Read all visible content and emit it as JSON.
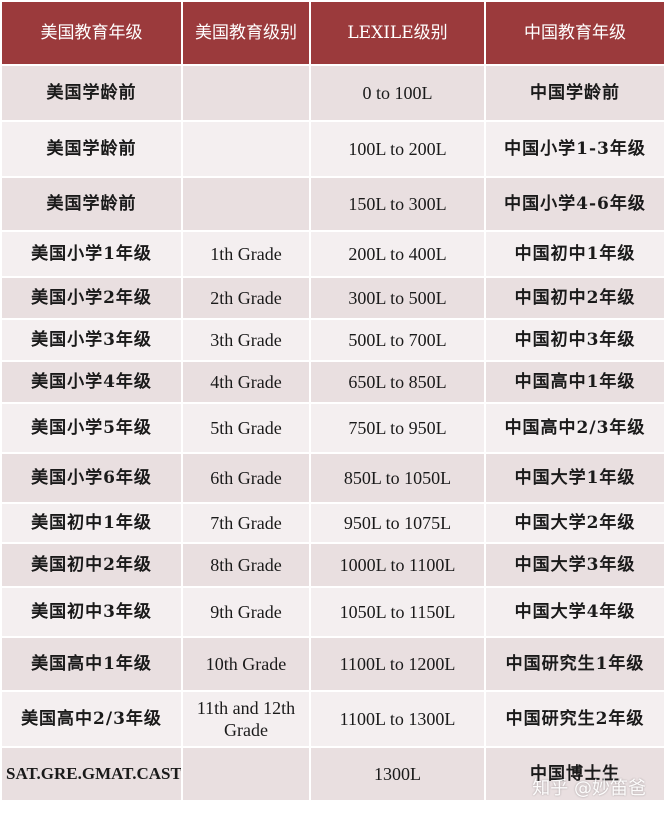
{
  "table": {
    "headers": [
      "美国教育年级",
      "美国教育级别",
      "LEXILE级别",
      "中国教育年级"
    ],
    "rows": [
      [
        "美国学龄前",
        "",
        "0 to 100L",
        "中国学龄前"
      ],
      [
        "美国学龄前",
        "",
        "100L to 200L",
        "中国小学1-3年级"
      ],
      [
        "美国学龄前",
        "",
        "150L to 300L",
        "中国小学4-6年级"
      ],
      [
        "美国小学1年级",
        "1th Grade",
        "200L to 400L",
        "中国初中1年级"
      ],
      [
        "美国小学2年级",
        "2th Grade",
        "300L to 500L",
        "中国初中2年级"
      ],
      [
        "美国小学3年级",
        "3th Grade",
        "500L to 700L",
        "中国初中3年级"
      ],
      [
        "美国小学4年级",
        "4th Grade",
        "650L to 850L",
        "中国高中1年级"
      ],
      [
        "美国小学5年级",
        "5th Grade",
        "750L to 950L",
        "中国高中2/3年级"
      ],
      [
        "美国小学6年级",
        "6th Grade",
        "850L to 1050L",
        "中国大学1年级"
      ],
      [
        "美国初中1年级",
        "7th Grade",
        "950L to 1075L",
        "中国大学2年级"
      ],
      [
        "美国初中2年级",
        "8th Grade",
        "1000L to 1100L",
        "中国大学3年级"
      ],
      [
        "美国初中3年级",
        "9th Grade",
        "1050L to 1150L",
        "中国大学4年级"
      ],
      [
        "美国高中1年级",
        "10th Grade",
        "1100L to 1200L",
        "中国研究生1年级"
      ],
      [
        "美国高中2/3年级",
        "11th and 12th Grade",
        "1100L to 1300L",
        "中国研究生2年级"
      ],
      [
        "SAT.GRE.GMAT.CAST",
        "",
        "1300L",
        "中国博士生"
      ]
    ]
  },
  "watermark": "知乎 @妙笛爸",
  "colors": {
    "header_bg": "#9b3a3c",
    "row_even": "#e9dfe0",
    "row_odd": "#f4eff0"
  }
}
